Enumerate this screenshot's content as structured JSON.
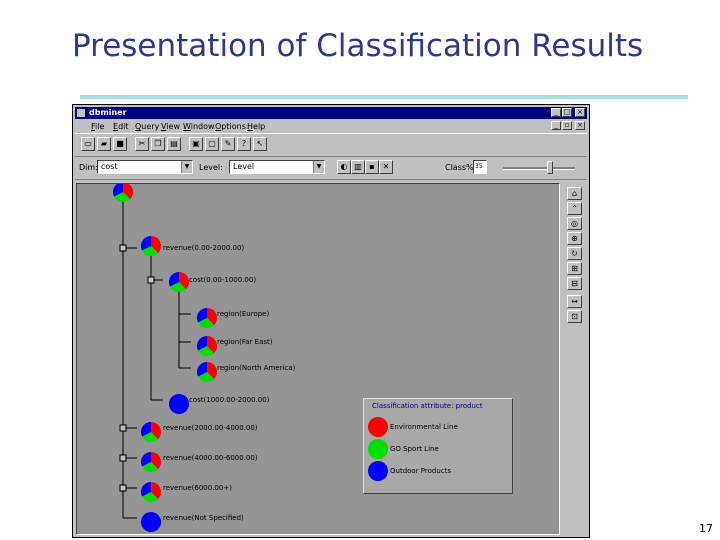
{
  "slide": {
    "title": "Presentation of Classification Results",
    "page_number": "17"
  },
  "window": {
    "title": "dbminer",
    "controls": [
      "_",
      "□",
      "×"
    ],
    "menu": [
      "File",
      "Edit",
      "Query",
      "View",
      "Window",
      "Options",
      "Help"
    ],
    "toolbar2": {
      "dim_label": "Dim:",
      "dim_value": "cost",
      "level_label": "Level:",
      "level_value": "Level",
      "class_label": "Class%",
      "class_value": "35"
    }
  },
  "tree": {
    "nodes": [
      {
        "label": "",
        "kind": "pie"
      },
      {
        "label": "revenue(0.00-2000.00)",
        "kind": "pie"
      },
      {
        "label": "cost(0.00-1000.00)",
        "kind": "pie"
      },
      {
        "label": "region(Europe)",
        "kind": "pie"
      },
      {
        "label": "region(Far East)",
        "kind": "pie"
      },
      {
        "label": "region(North America)",
        "kind": "pie"
      },
      {
        "label": "cost(1000.00-2000.00)",
        "kind": "solid"
      },
      {
        "label": "revenue(2000.00-4000.00)",
        "kind": "pie"
      },
      {
        "label": "revenue(4000.00-6000.00)",
        "kind": "pie"
      },
      {
        "label": "revenue(6000.00+)",
        "kind": "pie"
      },
      {
        "label": "revenue(Not Specified)",
        "kind": "solid"
      }
    ]
  },
  "legend": {
    "title": "Classification attribute: product",
    "items": [
      {
        "label": "Environmental Line",
        "color": "#ff0000"
      },
      {
        "label": "GO Sport Line",
        "color": "#00dd00"
      },
      {
        "label": "Outdoor Products",
        "color": "#0000ff"
      }
    ]
  },
  "colors": {
    "title_text": "#2e3a86",
    "title_rule": "#a9dede",
    "titlebar": "#000080",
    "canvas": "#949494",
    "pie_red": "#ff0000",
    "pie_green": "#00dd00",
    "pie_blue": "#0000ff"
  },
  "icons": {
    "toolbar1": [
      "new-icon",
      "open-icon",
      "save-icon",
      "cut-icon",
      "copy-icon",
      "paste-icon",
      "print-icon",
      "preview-icon",
      "chart-icon",
      "help-icon",
      "context-help-icon"
    ],
    "toolbar2": [
      "chart-type-icon",
      "bar-icon",
      "save-view-icon",
      "close-view-icon"
    ],
    "side": [
      "home-icon",
      "up-icon",
      "drill-icon",
      "zoom-icon",
      "rotate-icon",
      "expand-icon",
      "collapse-icon",
      "move-icon",
      "fit-icon"
    ]
  }
}
